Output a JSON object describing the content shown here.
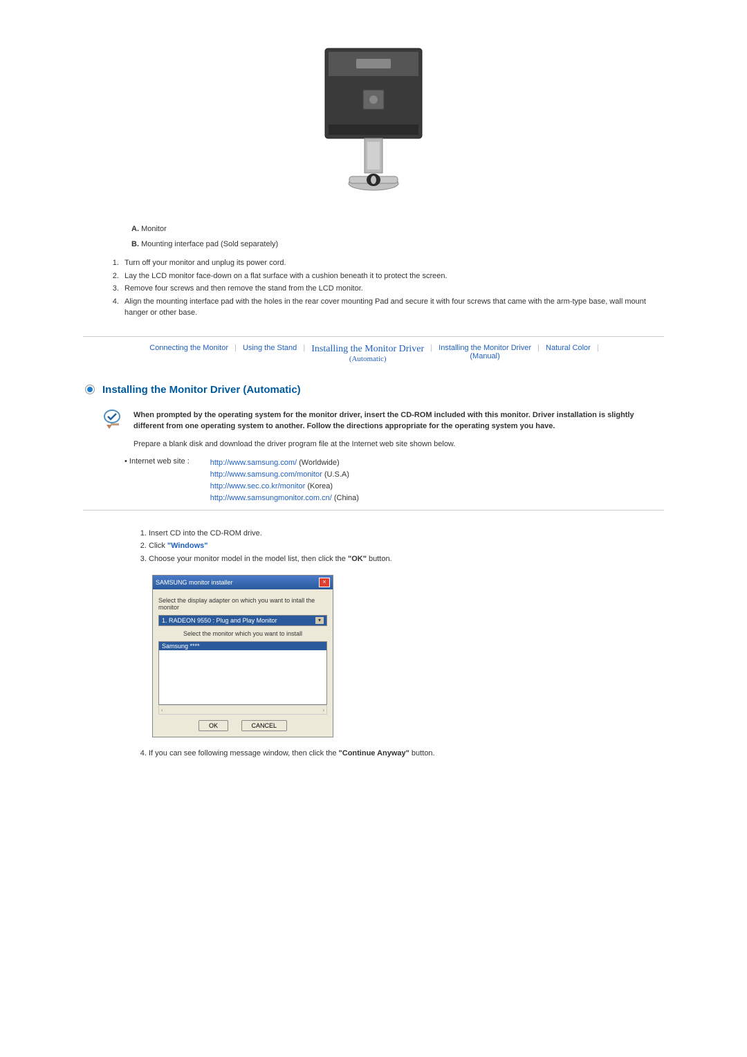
{
  "labels": {
    "a": {
      "prefix": "A.",
      "text": "Monitor"
    },
    "b": {
      "prefix": "B.",
      "text": "Mounting interface pad (Sold separately)"
    }
  },
  "mount_steps": [
    "Turn off your monitor and unplug its power cord.",
    "Lay the LCD monitor face-down on a flat surface with a cushion beneath it to protect the screen.",
    "Remove four screws and then remove the stand from the LCD monitor.",
    "Align the mounting interface pad with the holes in the rear cover mounting Pad and secure it with four screws that came with the arm-type base, wall mount hanger or other base."
  ],
  "nav": {
    "connecting": "Connecting  the Monitor",
    "stand": "Using the Stand",
    "driver_auto": "Installing the Monitor Driver",
    "driver_auto_sub": "(Automatic)",
    "driver_manual": "Installing the Monitor Driver",
    "driver_manual_sub": "(Manual)",
    "natural": "Natural Color"
  },
  "section_title": "Installing the Monitor Driver (Automatic)",
  "intro": "When prompted by the operating system for the monitor driver, insert the CD-ROM included with this monitor. Driver installation is slightly different from one operating system to another. Follow the directions appropriate for the operating system you have.",
  "prepare": "Prepare a blank disk and download the driver program file at the Internet web site shown below.",
  "links": {
    "label": "Internet web site :",
    "rows": [
      {
        "url": "http://www.samsung.com/",
        "region": " (Worldwide)"
      },
      {
        "url": "http://www.samsung.com/monitor",
        "region": " (U.S.A)"
      },
      {
        "url": "http://www.sec.co.kr/monitor",
        "region": " (Korea)"
      },
      {
        "url": "http://www.samsungmonitor.com.cn/",
        "region": " (China)"
      }
    ]
  },
  "install_steps": {
    "s1": "Insert CD into the CD-ROM drive.",
    "s2_prefix": "Click ",
    "s2_link": "\"Windows\"",
    "s3_prefix": "Choose your monitor model in the model list, then click the ",
    "s3_bold": "\"OK\"",
    "s3_suffix": " button."
  },
  "installer": {
    "title": "SAMSUNG monitor installer",
    "label1": "Select the display adapter on which you want to intall the monitor",
    "dropdown": "1. RADEON 9550 : Plug and Play Monitor",
    "label2": "Select the monitor which you want to install",
    "list_item": "Samsung ****",
    "ok": "OK",
    "cancel": "CANCEL"
  },
  "step4": {
    "prefix": "If you can see following message window, then click the ",
    "bold": "\"Continue Anyway\"",
    "suffix": " button."
  }
}
